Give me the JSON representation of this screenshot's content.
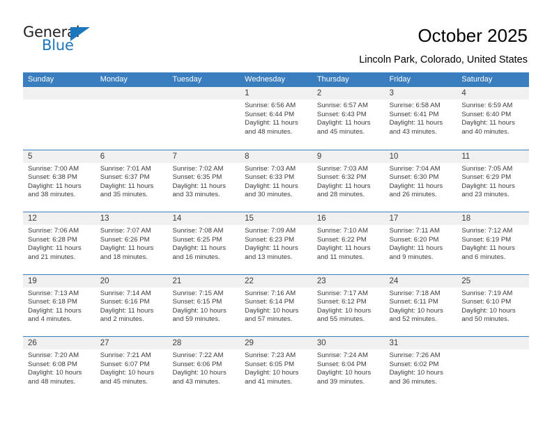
{
  "brand": {
    "name_part1": "General",
    "name_part2": "Blue",
    "accent_color": "#1b76bc"
  },
  "header": {
    "title": "October 2025",
    "subtitle": "Lincoln Park, Colorado, United States"
  },
  "calendar": {
    "header_color": "#3a7ebf",
    "weekdays": [
      "Sunday",
      "Monday",
      "Tuesday",
      "Wednesday",
      "Thursday",
      "Friday",
      "Saturday"
    ],
    "weeks": [
      [
        {
          "day": "",
          "empty": true,
          "sunrise": "",
          "sunset": "",
          "daylight_line1": "",
          "daylight_line2": ""
        },
        {
          "day": "",
          "empty": true,
          "sunrise": "",
          "sunset": "",
          "daylight_line1": "",
          "daylight_line2": ""
        },
        {
          "day": "",
          "empty": true,
          "sunrise": "",
          "sunset": "",
          "daylight_line1": "",
          "daylight_line2": ""
        },
        {
          "day": "1",
          "sunrise": "Sunrise: 6:56 AM",
          "sunset": "Sunset: 6:44 PM",
          "daylight_line1": "Daylight: 11 hours",
          "daylight_line2": "and 48 minutes."
        },
        {
          "day": "2",
          "sunrise": "Sunrise: 6:57 AM",
          "sunset": "Sunset: 6:43 PM",
          "daylight_line1": "Daylight: 11 hours",
          "daylight_line2": "and 45 minutes."
        },
        {
          "day": "3",
          "sunrise": "Sunrise: 6:58 AM",
          "sunset": "Sunset: 6:41 PM",
          "daylight_line1": "Daylight: 11 hours",
          "daylight_line2": "and 43 minutes."
        },
        {
          "day": "4",
          "sunrise": "Sunrise: 6:59 AM",
          "sunset": "Sunset: 6:40 PM",
          "daylight_line1": "Daylight: 11 hours",
          "daylight_line2": "and 40 minutes."
        }
      ],
      [
        {
          "day": "5",
          "sunrise": "Sunrise: 7:00 AM",
          "sunset": "Sunset: 6:38 PM",
          "daylight_line1": "Daylight: 11 hours",
          "daylight_line2": "and 38 minutes."
        },
        {
          "day": "6",
          "sunrise": "Sunrise: 7:01 AM",
          "sunset": "Sunset: 6:37 PM",
          "daylight_line1": "Daylight: 11 hours",
          "daylight_line2": "and 35 minutes."
        },
        {
          "day": "7",
          "sunrise": "Sunrise: 7:02 AM",
          "sunset": "Sunset: 6:35 PM",
          "daylight_line1": "Daylight: 11 hours",
          "daylight_line2": "and 33 minutes."
        },
        {
          "day": "8",
          "sunrise": "Sunrise: 7:03 AM",
          "sunset": "Sunset: 6:33 PM",
          "daylight_line1": "Daylight: 11 hours",
          "daylight_line2": "and 30 minutes."
        },
        {
          "day": "9",
          "sunrise": "Sunrise: 7:03 AM",
          "sunset": "Sunset: 6:32 PM",
          "daylight_line1": "Daylight: 11 hours",
          "daylight_line2": "and 28 minutes."
        },
        {
          "day": "10",
          "sunrise": "Sunrise: 7:04 AM",
          "sunset": "Sunset: 6:30 PM",
          "daylight_line1": "Daylight: 11 hours",
          "daylight_line2": "and 26 minutes."
        },
        {
          "day": "11",
          "sunrise": "Sunrise: 7:05 AM",
          "sunset": "Sunset: 6:29 PM",
          "daylight_line1": "Daylight: 11 hours",
          "daylight_line2": "and 23 minutes."
        }
      ],
      [
        {
          "day": "12",
          "sunrise": "Sunrise: 7:06 AM",
          "sunset": "Sunset: 6:28 PM",
          "daylight_line1": "Daylight: 11 hours",
          "daylight_line2": "and 21 minutes."
        },
        {
          "day": "13",
          "sunrise": "Sunrise: 7:07 AM",
          "sunset": "Sunset: 6:26 PM",
          "daylight_line1": "Daylight: 11 hours",
          "daylight_line2": "and 18 minutes."
        },
        {
          "day": "14",
          "sunrise": "Sunrise: 7:08 AM",
          "sunset": "Sunset: 6:25 PM",
          "daylight_line1": "Daylight: 11 hours",
          "daylight_line2": "and 16 minutes."
        },
        {
          "day": "15",
          "sunrise": "Sunrise: 7:09 AM",
          "sunset": "Sunset: 6:23 PM",
          "daylight_line1": "Daylight: 11 hours",
          "daylight_line2": "and 13 minutes."
        },
        {
          "day": "16",
          "sunrise": "Sunrise: 7:10 AM",
          "sunset": "Sunset: 6:22 PM",
          "daylight_line1": "Daylight: 11 hours",
          "daylight_line2": "and 11 minutes."
        },
        {
          "day": "17",
          "sunrise": "Sunrise: 7:11 AM",
          "sunset": "Sunset: 6:20 PM",
          "daylight_line1": "Daylight: 11 hours",
          "daylight_line2": "and 9 minutes."
        },
        {
          "day": "18",
          "sunrise": "Sunrise: 7:12 AM",
          "sunset": "Sunset: 6:19 PM",
          "daylight_line1": "Daylight: 11 hours",
          "daylight_line2": "and 6 minutes."
        }
      ],
      [
        {
          "day": "19",
          "sunrise": "Sunrise: 7:13 AM",
          "sunset": "Sunset: 6:18 PM",
          "daylight_line1": "Daylight: 11 hours",
          "daylight_line2": "and 4 minutes."
        },
        {
          "day": "20",
          "sunrise": "Sunrise: 7:14 AM",
          "sunset": "Sunset: 6:16 PM",
          "daylight_line1": "Daylight: 11 hours",
          "daylight_line2": "and 2 minutes."
        },
        {
          "day": "21",
          "sunrise": "Sunrise: 7:15 AM",
          "sunset": "Sunset: 6:15 PM",
          "daylight_line1": "Daylight: 10 hours",
          "daylight_line2": "and 59 minutes."
        },
        {
          "day": "22",
          "sunrise": "Sunrise: 7:16 AM",
          "sunset": "Sunset: 6:14 PM",
          "daylight_line1": "Daylight: 10 hours",
          "daylight_line2": "and 57 minutes."
        },
        {
          "day": "23",
          "sunrise": "Sunrise: 7:17 AM",
          "sunset": "Sunset: 6:12 PM",
          "daylight_line1": "Daylight: 10 hours",
          "daylight_line2": "and 55 minutes."
        },
        {
          "day": "24",
          "sunrise": "Sunrise: 7:18 AM",
          "sunset": "Sunset: 6:11 PM",
          "daylight_line1": "Daylight: 10 hours",
          "daylight_line2": "and 52 minutes."
        },
        {
          "day": "25",
          "sunrise": "Sunrise: 7:19 AM",
          "sunset": "Sunset: 6:10 PM",
          "daylight_line1": "Daylight: 10 hours",
          "daylight_line2": "and 50 minutes."
        }
      ],
      [
        {
          "day": "26",
          "sunrise": "Sunrise: 7:20 AM",
          "sunset": "Sunset: 6:08 PM",
          "daylight_line1": "Daylight: 10 hours",
          "daylight_line2": "and 48 minutes."
        },
        {
          "day": "27",
          "sunrise": "Sunrise: 7:21 AM",
          "sunset": "Sunset: 6:07 PM",
          "daylight_line1": "Daylight: 10 hours",
          "daylight_line2": "and 45 minutes."
        },
        {
          "day": "28",
          "sunrise": "Sunrise: 7:22 AM",
          "sunset": "Sunset: 6:06 PM",
          "daylight_line1": "Daylight: 10 hours",
          "daylight_line2": "and 43 minutes."
        },
        {
          "day": "29",
          "sunrise": "Sunrise: 7:23 AM",
          "sunset": "Sunset: 6:05 PM",
          "daylight_line1": "Daylight: 10 hours",
          "daylight_line2": "and 41 minutes."
        },
        {
          "day": "30",
          "sunrise": "Sunrise: 7:24 AM",
          "sunset": "Sunset: 6:04 PM",
          "daylight_line1": "Daylight: 10 hours",
          "daylight_line2": "and 39 minutes."
        },
        {
          "day": "31",
          "sunrise": "Sunrise: 7:26 AM",
          "sunset": "Sunset: 6:02 PM",
          "daylight_line1": "Daylight: 10 hours",
          "daylight_line2": "and 36 minutes."
        },
        {
          "day": "",
          "empty": true,
          "sunrise": "",
          "sunset": "",
          "daylight_line1": "",
          "daylight_line2": ""
        }
      ]
    ]
  }
}
